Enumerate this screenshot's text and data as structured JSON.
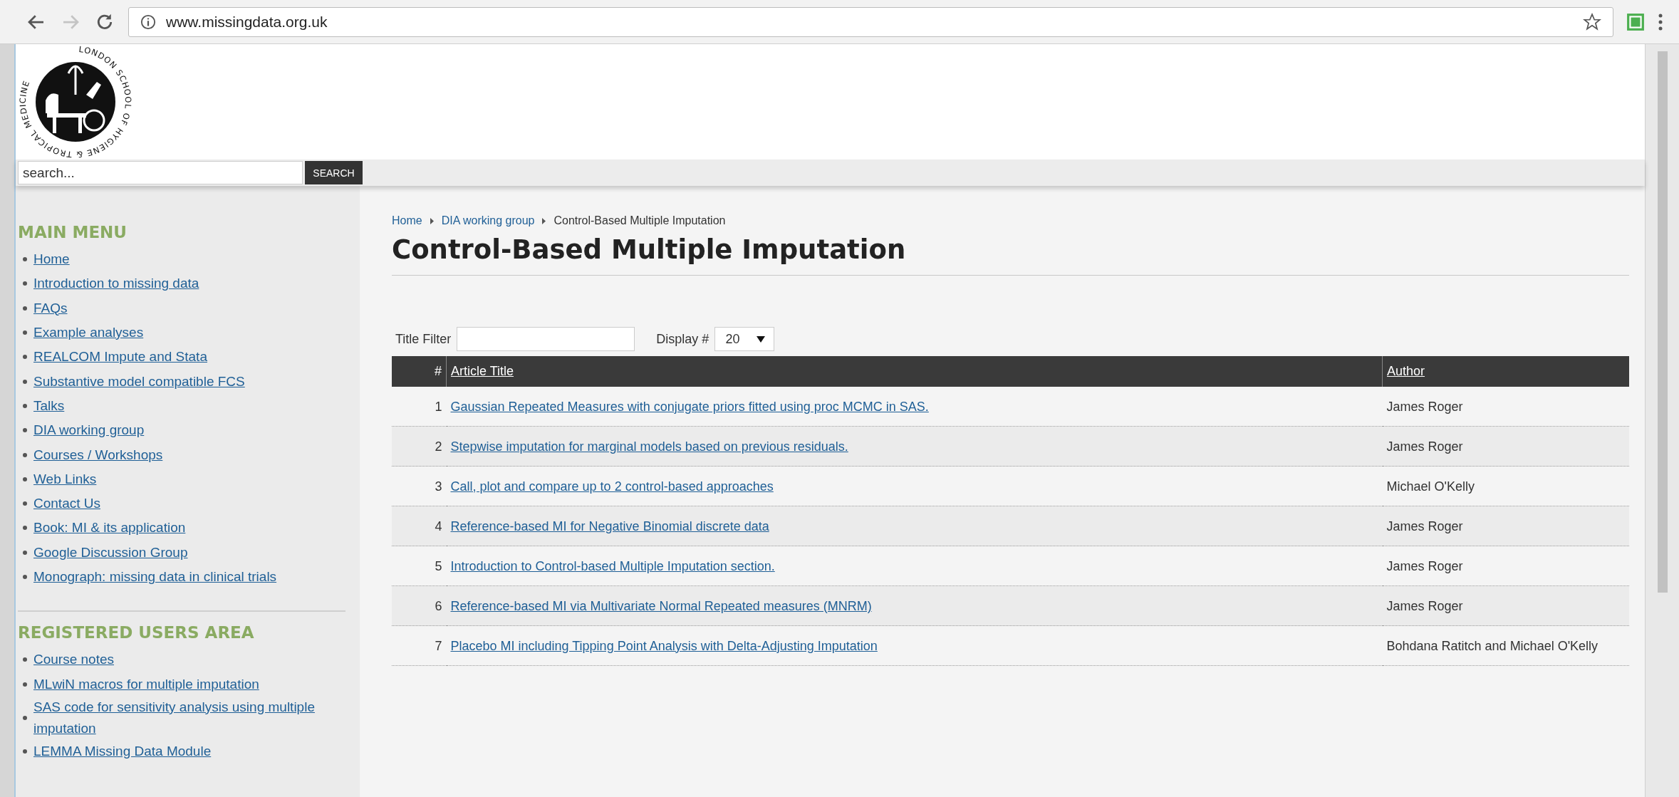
{
  "browser": {
    "url": "www.missingdata.org.uk"
  },
  "header": {
    "logo_text": "LONDON SCHOOL OF HYGIENE & TROPICAL MEDICINE",
    "search": {
      "placeholder": "search...",
      "button": "SEARCH"
    }
  },
  "sidebar": {
    "sections": [
      {
        "title": "MAIN MENU",
        "items": [
          "Home",
          "Introduction to missing data",
          "FAQs",
          "Example analyses",
          "REALCOM Impute and Stata",
          "Substantive model compatible FCS",
          "Talks",
          "DIA working group",
          "Courses / Workshops",
          "Web Links",
          "Contact Us",
          "Book: MI & its application",
          "Google Discussion Group",
          "Monograph: missing data in clinical trials"
        ]
      },
      {
        "title": "REGISTERED USERS AREA",
        "items": [
          "Course notes",
          "MLwiN macros for multiple imputation",
          "SAS code for sensitivity analysis using multiple imputation",
          "LEMMA Missing Data Module"
        ]
      }
    ]
  },
  "breadcrumb": [
    "Home",
    "DIA working group",
    "Control-Based Multiple Imputation"
  ],
  "title": "Control-Based Multiple Imputation",
  "filter": {
    "label": "Title Filter",
    "display_label": "Display #",
    "display_value": "20"
  },
  "table": {
    "columns": [
      "#",
      "Article Title",
      "Author"
    ],
    "rows": [
      {
        "number": "1",
        "title": "Gaussian Repeated Measures with conjugate priors fitted using proc MCMC in SAS.",
        "author": "James Roger"
      },
      {
        "number": "2",
        "title": "Stepwise imputation for marginal models based on previous residuals.",
        "author": "James Roger"
      },
      {
        "number": "3",
        "title": "Call, plot and compare up to 2 control-based approaches",
        "author": "Michael O'Kelly"
      },
      {
        "number": "4",
        "title": "Reference-based MI for Negative Binomial discrete data",
        "author": "James Roger"
      },
      {
        "number": "5",
        "title": "Introduction to Control-based Multiple Imputation section.",
        "author": "James Roger"
      },
      {
        "number": "6",
        "title": "Reference-based MI via Multivariate Normal Repeated measures (MNRM)",
        "author": "James Roger"
      },
      {
        "number": "7",
        "title": "Placebo MI including Tipping Point Analysis with Delta-Adjusting Imputation",
        "author": "Bohdana Ratitch and Michael O'Kelly"
      }
    ]
  }
}
